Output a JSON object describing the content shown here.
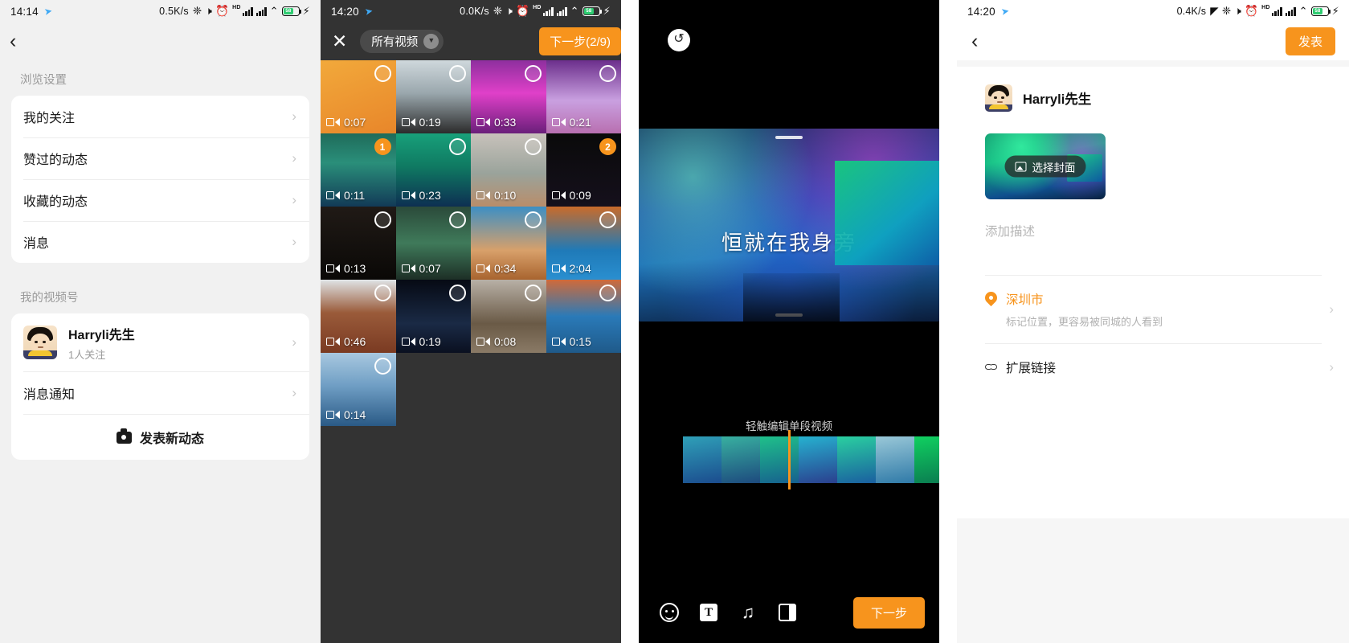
{
  "panel1": {
    "status": {
      "time": "14:14",
      "net": "0.5K/s",
      "battery": "58"
    },
    "section1_label": "浏览设置",
    "menu": [
      {
        "label": "我的关注"
      },
      {
        "label": "赞过的动态"
      },
      {
        "label": "收藏的动态"
      },
      {
        "label": "消息"
      }
    ],
    "section2_label": "我的视频号",
    "profile": {
      "name": "Harryli先生",
      "followers": "1人关注"
    },
    "notify_label": "消息通知",
    "post_label": "发表新动态"
  },
  "panel2": {
    "status": {
      "time": "14:20",
      "net": "0.0K/s",
      "battery": "58"
    },
    "filter_label": "所有视频",
    "next_label": "下一步(2/9)",
    "videos": [
      {
        "duration": "0:07",
        "selected": false,
        "badge": "",
        "bg": "linear-gradient(160deg,#f2a93b,#e8862a)"
      },
      {
        "duration": "0:19",
        "selected": false,
        "badge": "",
        "bg": "linear-gradient(180deg,#cfd8dc 0%,#9aa7ad 45%,#2b2b2b 100%)"
      },
      {
        "duration": "0:33",
        "selected": false,
        "badge": "",
        "bg": "linear-gradient(180deg,#8e2f9e,#e040c9 45%,#6a1f7a)"
      },
      {
        "duration": "0:21",
        "selected": false,
        "badge": "",
        "bg": "linear-gradient(180deg,#6c2f8c,#c9a0e0 55%,#b86fb0)"
      },
      {
        "duration": "0:11",
        "selected": true,
        "badge": "1",
        "bg": "linear-gradient(180deg,#1f6b5a,#2a8f7a 40%,#123a57)"
      },
      {
        "duration": "0:23",
        "selected": false,
        "badge": "",
        "bg": "linear-gradient(180deg,#18a07a,#0f7a62 45%,#0d2f52)"
      },
      {
        "duration": "0:10",
        "selected": false,
        "badge": "",
        "bg": "linear-gradient(180deg,#c8c2bb,#9aa39b 55%,#b98d6a)"
      },
      {
        "duration": "0:09",
        "selected": true,
        "badge": "2",
        "bg": "linear-gradient(180deg,#0a0a0a,#15101c)"
      },
      {
        "duration": "0:13",
        "selected": false,
        "badge": "",
        "bg": "linear-gradient(180deg,#201a16,#0a0806)"
      },
      {
        "duration": "0:07",
        "selected": false,
        "badge": "",
        "bg": "linear-gradient(180deg,#2b4a3a,#3f7a5a 50%,#1d2f26)"
      },
      {
        "duration": "0:34",
        "selected": false,
        "badge": "",
        "bg": "linear-gradient(180deg,#3d8fc4,#d8a06a 60%,#a8642f)"
      },
      {
        "duration": "2:04",
        "selected": false,
        "badge": "",
        "bg": "linear-gradient(180deg,#c96b2a,#1f7ab8 60%,#2a8fd0)"
      },
      {
        "duration": "0:46",
        "selected": false,
        "badge": "",
        "bg": "linear-gradient(180deg,#dfe3e6,#9a5b3a 45%,#7a3a22)"
      },
      {
        "duration": "0:19",
        "selected": false,
        "badge": "",
        "bg": "linear-gradient(180deg,#060a14,#1a2a45 60%,#0a1020)"
      },
      {
        "duration": "0:08",
        "selected": false,
        "badge": "",
        "bg": "linear-gradient(180deg,#b8b0a6,#6a5a46 60%,#8a7a66)"
      },
      {
        "duration": "0:15",
        "selected": false,
        "badge": "",
        "bg": "linear-gradient(180deg,#d06a3a,#2a7ab8 50%,#1f5a8a)"
      },
      {
        "duration": "0:14",
        "selected": false,
        "badge": "",
        "bg": "linear-gradient(180deg,#a8c8e0,#6f9ec4 45%,#2a5a86)"
      }
    ]
  },
  "panel3": {
    "undo_icon": "undo-icon",
    "preview_caption": "恒就在我身旁",
    "timeline_tip": "轻触编辑单段视频",
    "tools": [
      {
        "name": "emoji-icon"
      },
      {
        "name": "text-icon"
      },
      {
        "name": "music-icon"
      },
      {
        "name": "ratio-icon"
      }
    ],
    "next_label": "下一步"
  },
  "panel4": {
    "status": {
      "time": "14:20",
      "net": "0.4K/s",
      "battery": "58"
    },
    "publish_label": "发表",
    "user_name": "Harryli先生",
    "cover_label": "选择封面",
    "desc_placeholder": "添加描述",
    "location": {
      "title": "深圳市",
      "subtitle": "标记位置，更容易被同城的人看到"
    },
    "link": {
      "title": "扩展链接"
    }
  }
}
